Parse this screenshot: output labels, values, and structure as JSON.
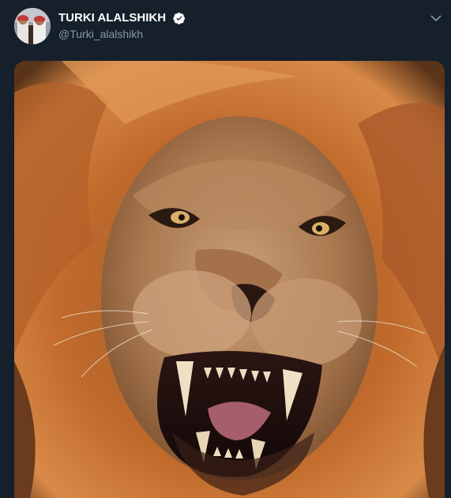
{
  "tweet": {
    "author": {
      "display_name": "TURKI ALALSHIKH",
      "handle": "@Turki_alalshikh",
      "verified": true,
      "avatar_icon": "avatar-photo"
    },
    "menu_icon": "chevron-down-icon",
    "media": {
      "type": "photo",
      "subject": "roaring-lion-photo"
    }
  },
  "colors": {
    "background": "#15202b",
    "secondary_text": "#8899a6",
    "verified_badge": "#ffffff"
  }
}
